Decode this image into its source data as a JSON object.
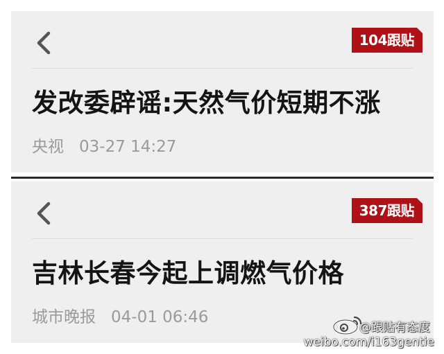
{
  "posts": [
    {
      "badge": "104跟贴",
      "headline": "发改委辟谣:天然气价短期不涨",
      "source": "央视",
      "time": "03-27 14:27"
    },
    {
      "badge": "387跟贴",
      "headline": "吉林长春今起上调燃气价格",
      "source": "城市晚报",
      "time": "04-01 06:46"
    }
  ],
  "watermark": {
    "handle": "@跟贴有态度",
    "url": "weibo.com/i163gentie"
  },
  "colors": {
    "badge": "#b01116",
    "card": "#efefef",
    "meta": "#9a9a9a"
  }
}
